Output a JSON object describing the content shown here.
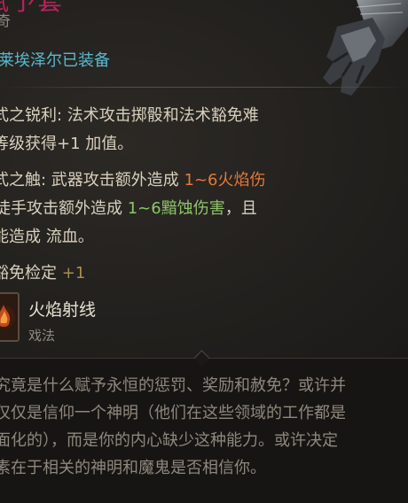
{
  "item": {
    "title_fragment": "赋予套",
    "rarity_fragment": "奇",
    "equipped_text": "莱埃泽尔已装备"
  },
  "properties": {
    "line1": "式之锐利: 法术攻击掷骰和法术豁免难",
    "line2": "等级获得+1 加值。",
    "line3_prefix": "式之触: 武器攻击额外造成 ",
    "line3_damage": "1~6火焰伤",
    "line4_prefix": "徒手攻击额外造成 ",
    "line4_damage": "1~6黯蚀伤害",
    "line4_suffix": "，且",
    "line5_prefix": "能造成 ",
    "line5_effect": "流血",
    "line5_suffix": "。",
    "save_label": "豁免检定 ",
    "save_bonus": "+1"
  },
  "spell": {
    "name": "火焰射线",
    "type": "戏法",
    "icon": "fire-ray-spell-icon"
  },
  "flavor": [
    "究竟是什么赋予永恒的惩罚、奖励和赦免？或许并",
    "仅仅是信仰一个神明（他们在这些领域的工作都是",
    "面化的），而是你的内心缺少这种能力。或许决定",
    "素在于相关的神明和魔鬼是否相信你。"
  ],
  "colors": {
    "title": "#b8245e",
    "equipped": "#59b9ce",
    "fire_damage": "#e2793a",
    "acid_damage": "#8fc46a",
    "bonus": "#a98d52",
    "body_text": "#d8d0bd",
    "flavor_text": "#8e877c"
  }
}
